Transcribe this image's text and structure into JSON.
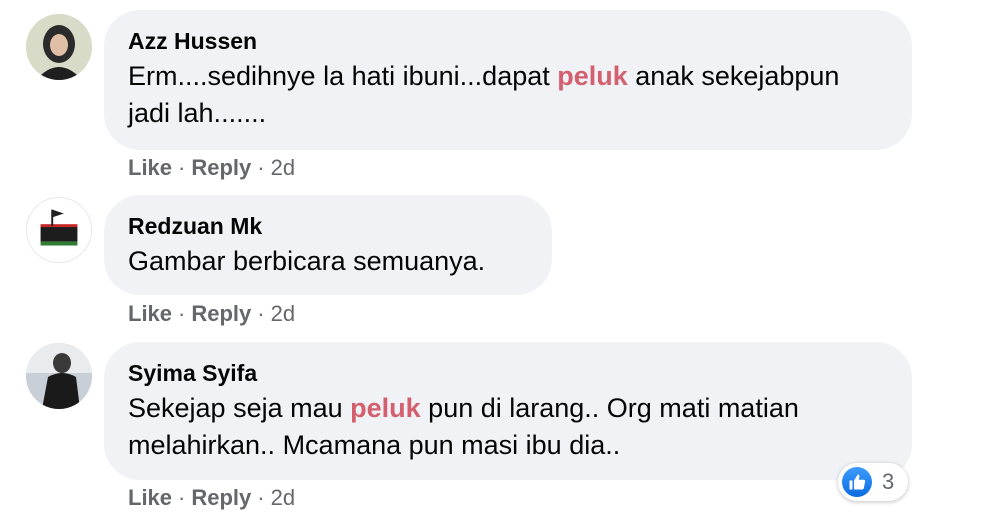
{
  "comments": [
    {
      "author": "Azz Hussen",
      "text_parts": [
        "Erm....sedihnye la hati ibuni...dapat ",
        "peluk",
        " anak sekejabpun jadi lah......."
      ],
      "actions": {
        "like": "Like",
        "reply": "Reply",
        "time": "2d"
      }
    },
    {
      "author": "Redzuan Mk",
      "text_parts": [
        "Gambar berbicara semuanya."
      ],
      "actions": {
        "like": "Like",
        "reply": "Reply",
        "time": "2d"
      }
    },
    {
      "author": "Syima Syifa",
      "text_parts": [
        "Sekejap seja mau ",
        "peluk",
        " pun di larang.. Org mati matian melahirkan.. Mcamana pun masi ibu dia.."
      ],
      "actions": {
        "like": "Like",
        "reply": "Reply",
        "time": "2d"
      },
      "reactions": {
        "icon": "thumbs-up-icon",
        "count": "3"
      }
    }
  ],
  "separator": "·",
  "colors": {
    "bubble": "#f0f2f5",
    "highlight": "#d2606f",
    "meta": "#65676b",
    "like_blue": "#1877f2"
  }
}
